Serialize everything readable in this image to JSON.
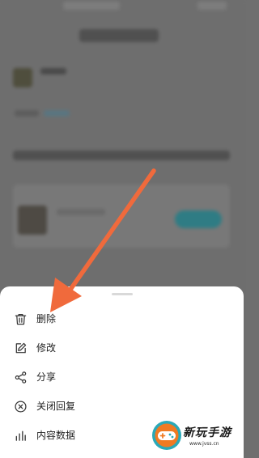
{
  "menu": {
    "items": [
      {
        "label": "删除",
        "icon": "trash-icon"
      },
      {
        "label": "修改",
        "icon": "edit-icon"
      },
      {
        "label": "分享",
        "icon": "share-icon"
      },
      {
        "label": "关闭回复",
        "icon": "close-circle-icon"
      },
      {
        "label": "内容数据",
        "icon": "bar-chart-icon"
      }
    ]
  },
  "watermark": {
    "name": "新玩手游",
    "url": "www.jvss.cn"
  },
  "colors": {
    "arrow": "#f06a3c",
    "sheet": "#ffffff",
    "overlay": "#6e6e6e",
    "logo_orange": "#f07a22",
    "logo_teal": "#2aa9b8"
  }
}
